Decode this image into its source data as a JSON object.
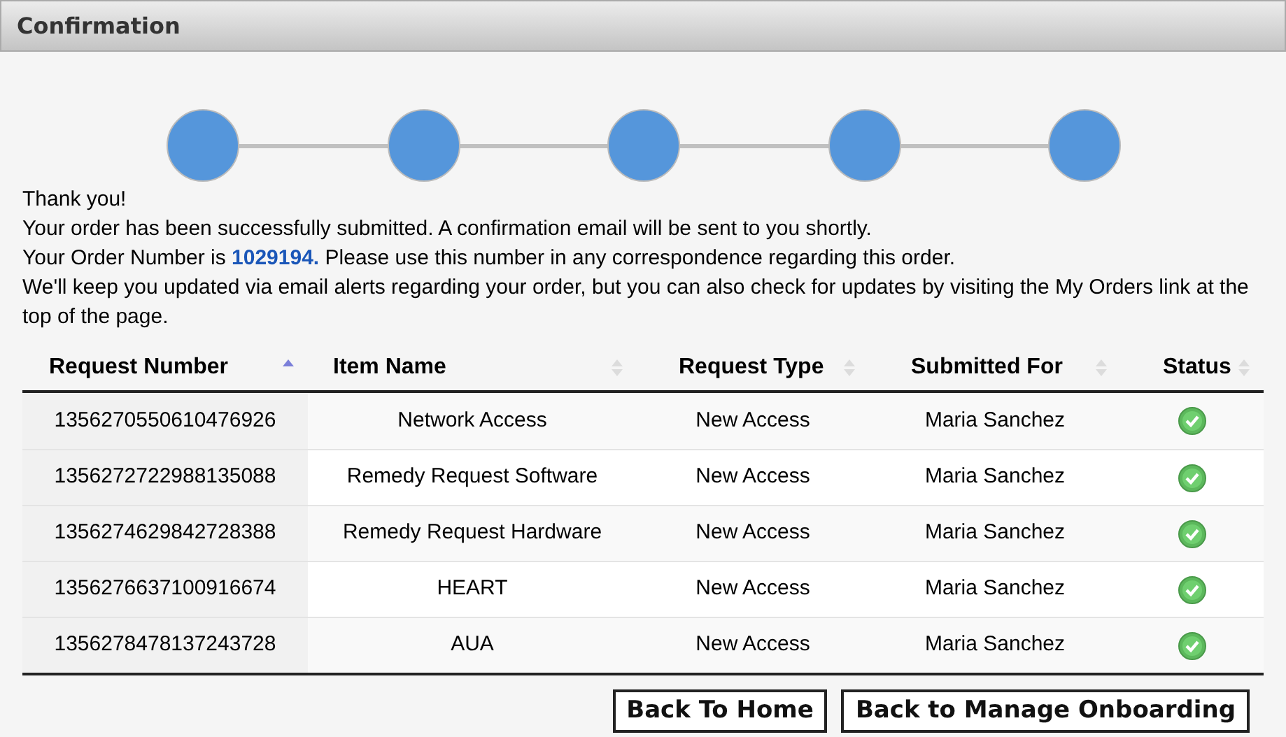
{
  "window": {
    "title": "Confirmation"
  },
  "steps": [
    {
      "completed": true
    },
    {
      "completed": true
    },
    {
      "completed": true
    },
    {
      "completed": true
    },
    {
      "completed": true
    }
  ],
  "messages": [
    "Thank you!",
    "Your order has been successfully submitted. A confirmation email will be sent to you shortly.",
    "Your Order Number is **1029194.** Please use this number in any correspondence regarding this order.",
    "We'll keep you updated via email alerts regarding your order, but you can also check for updates by visiting the My Orders link at the top of the page."
  ],
  "table": {
    "columns": [
      {
        "label": "Request Number",
        "sorted": true
      },
      {
        "label": "Item Name",
        "sorted": false
      },
      {
        "label": "Request Type",
        "sorted": false
      },
      {
        "label": "Submitted For",
        "sorted": false
      },
      {
        "label": "Status",
        "sorted": false
      }
    ],
    "rows": [
      {
        "request_number": "1356270550610476926",
        "item_name": "Network Access",
        "request_type": "New Access",
        "submitted_for": "Maria Sanchez",
        "complete": true
      },
      {
        "request_number": "1356272722988135088",
        "item_name": "Remedy Request Software",
        "request_type": "New Access",
        "submitted_for": "Maria Sanchez",
        "complete": true
      },
      {
        "request_number": "1356274629842728388",
        "item_name": "Remedy Request Hardware",
        "request_type": "New Access",
        "submitted_for": "Maria Sanchez",
        "complete": true
      },
      {
        "request_number": "1356276637100916674",
        "item_name": "HEART",
        "request_type": "New Access",
        "submitted_for": "Maria Sanchez",
        "complete": true
      },
      {
        "request_number": "1356278478137243728",
        "item_name": "AUA",
        "request_type": "New Access",
        "submitted_for": "Maria Sanchez",
        "complete": true
      }
    ]
  },
  "buttons": [
    "Back To Home",
    "Back to Manage Onboarding"
  ]
}
